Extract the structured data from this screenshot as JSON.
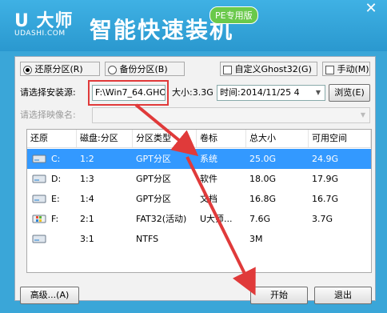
{
  "header": {
    "logo_text": "U 大师",
    "logo_sub": "UDASHI.COM",
    "title": "智能快速装机",
    "badge": "PE专用版",
    "close_glyph": "✕"
  },
  "options": {
    "restore_label": "还原分区(R)",
    "backup_label": "备份分区(B)",
    "custom_ghost_label": "自定义Ghost32(G)",
    "manual_label": "手动(M)"
  },
  "source": {
    "label": "请选择安装源:",
    "value": "F:\\Win7_64.GHO",
    "size_text": "大小:3.3G",
    "time_text": "时间:2014/11/25 4",
    "browse_label": "浏览(E)"
  },
  "image_name": {
    "label": "请选择映像名:",
    "value": ""
  },
  "table": {
    "headers": [
      "还原",
      "磁盘:分区",
      "分区类型",
      "卷标",
      "总大小",
      "可用空间"
    ],
    "rows": [
      {
        "drive": "C:",
        "disk": "1:2",
        "type": "GPT分区",
        "label": "系统",
        "total": "25.0G",
        "free": "24.9G",
        "icon": "hard-drive-icon"
      },
      {
        "drive": "D:",
        "disk": "1:3",
        "type": "GPT分区",
        "label": "软件",
        "total": "18.0G",
        "free": "17.9G",
        "icon": "hard-drive-icon"
      },
      {
        "drive": "E:",
        "disk": "1:4",
        "type": "GPT分区",
        "label": "文档",
        "total": "16.8G",
        "free": "16.7G",
        "icon": "hard-drive-icon"
      },
      {
        "drive": "F:",
        "disk": "2:1",
        "type": "FAT32(活动)",
        "label": "U大师...",
        "total": "7.6G",
        "free": "3.7G",
        "icon": "windows-drive-icon"
      },
      {
        "drive": "",
        "disk": "3:1",
        "type": "NTFS",
        "label": "",
        "total": "3M",
        "free": "",
        "icon": "hard-drive-icon"
      }
    ]
  },
  "buttons": {
    "advanced_label": "高级...(A)",
    "start_label": "开始",
    "exit_label": "退出"
  },
  "colors": {
    "frame": "#3aa6d8",
    "selection": "#3399ff",
    "annotation": "#e03a3a"
  }
}
